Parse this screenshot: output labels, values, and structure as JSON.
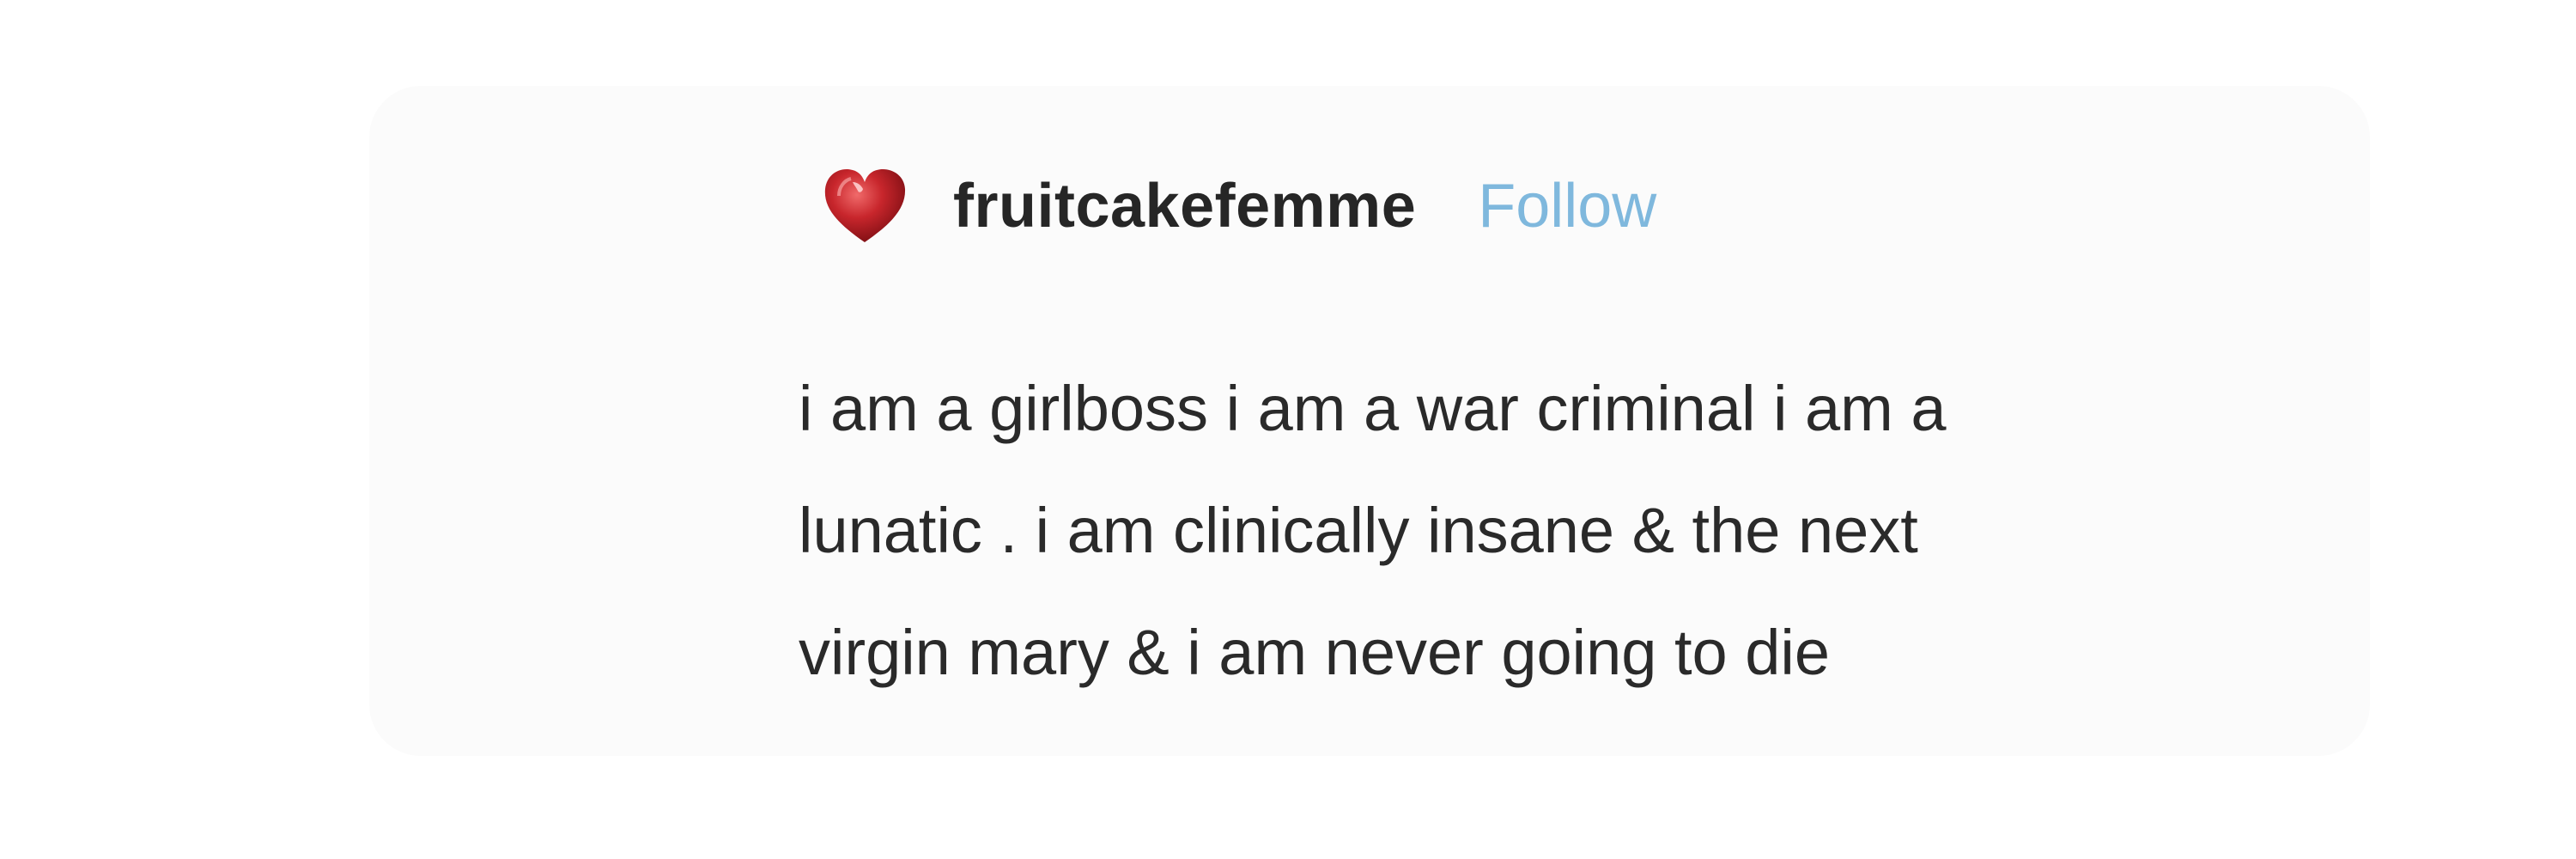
{
  "post": {
    "username": "fruitcakefemme",
    "follow_label": "Follow",
    "avatar_icon": "heart-icon",
    "lines": [
      "i am a girlboss i am a war criminal i am a",
      "lunatic . i am clinically insane & the next",
      "virgin mary & i am never going to die"
    ]
  },
  "colors": {
    "background": "#ffffff",
    "card": "#fbfbfb",
    "username": "#262626",
    "follow": "#7fb8dd",
    "body_text": "#2a2a2a",
    "heart": "#c0262b"
  }
}
